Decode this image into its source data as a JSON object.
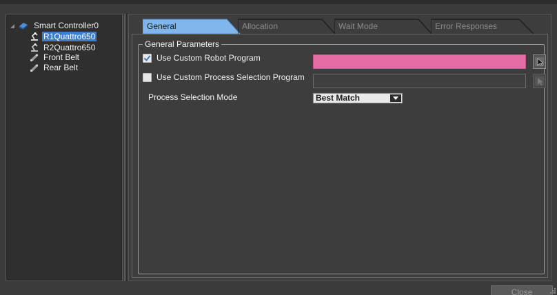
{
  "tree": {
    "root_label": "Smart Controller0",
    "items": [
      {
        "label": "R1Quattro650",
        "icon": "robot-arm-icon",
        "selected": true
      },
      {
        "label": "R2Quattro650",
        "icon": "robot-arm-icon",
        "selected": false
      },
      {
        "label": "Front Belt",
        "icon": "belt-icon",
        "selected": false
      },
      {
        "label": "Rear Belt",
        "icon": "belt-icon",
        "selected": false
      }
    ]
  },
  "tabs": [
    {
      "label": "General",
      "active": true
    },
    {
      "label": "Allocation",
      "active": false
    },
    {
      "label": "Wait Mode",
      "active": false
    },
    {
      "label": "Error Responses",
      "active": false
    }
  ],
  "general": {
    "group_title": "General Parameters",
    "use_robot_program": {
      "label": "Use Custom Robot Program",
      "checked": true,
      "value": ""
    },
    "use_process_selection": {
      "label": "Use Custom Process Selection Program",
      "checked": false,
      "value": ""
    },
    "process_selection_mode": {
      "label": "Process Selection Mode",
      "value": "Best Match"
    }
  },
  "footer": {
    "close_label": "Close"
  },
  "colors": {
    "selection": "#3a7fcf",
    "active_tab": "#7fb6ec",
    "required_field": "#e66ea6"
  }
}
